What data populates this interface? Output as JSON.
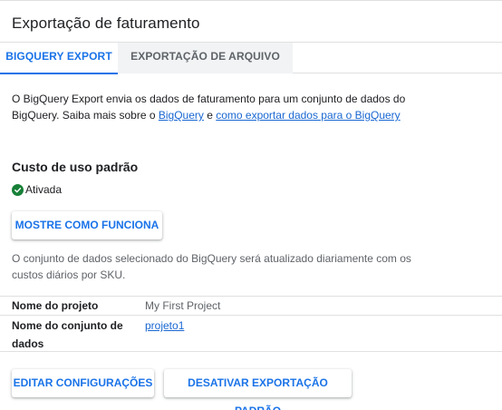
{
  "page": {
    "title": "Exportação de faturamento"
  },
  "tabs": [
    {
      "label": "BIGQUERY EXPORT",
      "active": true
    },
    {
      "label": "EXPORTAÇÃO DE ARQUIVO",
      "active": false
    }
  ],
  "description": {
    "text1": "O BigQuery Export envia os dados de faturamento para um conjunto de dados do BigQuery. Saiba mais sobre o ",
    "link1": "BigQuery",
    "text2": " e ",
    "link2": "como exportar dados para o BigQuery"
  },
  "section": {
    "title": "Custo de uso padrão",
    "status": "Ativada",
    "status_icon": "check-circle-icon",
    "status_color": "#188038",
    "show_how_button": "MOSTRE COMO FUNCIONA",
    "note": "O conjunto de dados selecionado do BigQuery será atualizado diariamente com os custos diários por SKU."
  },
  "details": {
    "project_label": "Nome do projeto",
    "project_value": "My First Project",
    "dataset_label": "Nome do conjunto de dados",
    "dataset_value": "projeto1"
  },
  "actions": {
    "edit_label": "EDITAR CONFIGURAÇÕES",
    "disable_label": "DESATIVAR EXPORTAÇÃO PADRÃO"
  },
  "colors": {
    "accent": "#1a73e8",
    "link": "#1967d2",
    "inactive_tab_bg": "#f1f3f4"
  }
}
